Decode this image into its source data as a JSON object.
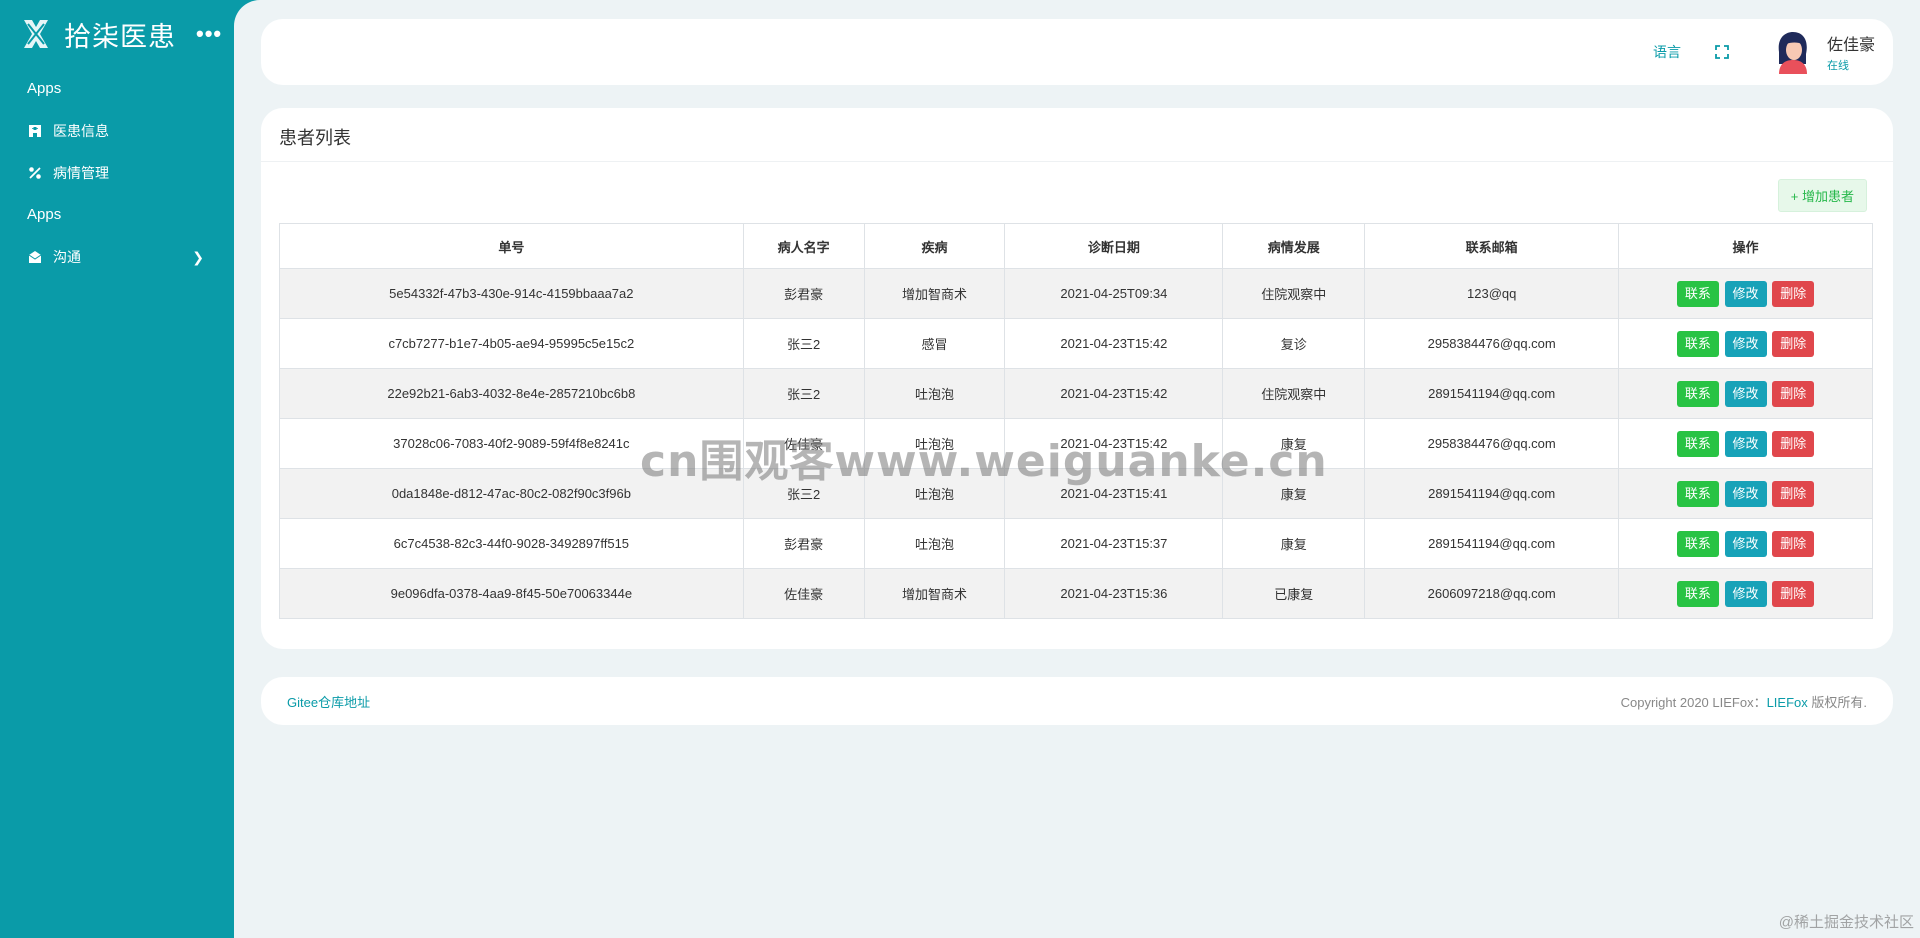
{
  "sidebar": {
    "brand_name": "拾柒医患",
    "more": "•••",
    "sections": [
      {
        "label": "Apps"
      },
      {
        "label": "Apps"
      }
    ],
    "items": [
      {
        "label": "医患信息",
        "icon": "hospital-icon"
      },
      {
        "label": "病情管理",
        "icon": "percent-icon"
      },
      {
        "label": "沟通",
        "icon": "envelope-icon"
      }
    ]
  },
  "header": {
    "language": "语言",
    "fullscreen_icon": "fullscreen-icon",
    "user_name": "佐佳豪",
    "user_status": "在线"
  },
  "card": {
    "title": "患者列表",
    "add_button": "+ 增加患者"
  },
  "table": {
    "headers": [
      "单号",
      "病人名字",
      "疾病",
      "诊断日期",
      "病情发展",
      "联系邮箱",
      "操作"
    ],
    "rows": [
      {
        "id": "5e54332f-47b3-430e-914c-4159bbaaa7a2",
        "name": "彭君豪",
        "disease": "增加智商术",
        "date": "2021-04-25T09:34",
        "progress": "住院观察中",
        "email": "123@qq"
      },
      {
        "id": "c7cb7277-b1e7-4b05-ae94-95995c5e15c2",
        "name": "张三2",
        "disease": "感冒",
        "date": "2021-04-23T15:42",
        "progress": "复诊",
        "email": "2958384476@qq.com"
      },
      {
        "id": "22e92b21-6ab3-4032-8e4e-2857210bc6b8",
        "name": "张三2",
        "disease": "吐泡泡",
        "date": "2021-04-23T15:42",
        "progress": "住院观察中",
        "email": "2891541194@qq.com"
      },
      {
        "id": "37028c06-7083-40f2-9089-59f4f8e8241c",
        "name": "佐佳豪",
        "disease": "吐泡泡",
        "date": "2021-04-23T15:42",
        "progress": "康复",
        "email": "2958384476@qq.com"
      },
      {
        "id": "0da1848e-d812-47ac-80c2-082f90c3f96b",
        "name": "张三2",
        "disease": "吐泡泡",
        "date": "2021-04-23T15:41",
        "progress": "康复",
        "email": "2891541194@qq.com"
      },
      {
        "id": "6c7c4538-82c3-44f0-9028-3492897ff515",
        "name": "彭君豪",
        "disease": "吐泡泡",
        "date": "2021-04-23T15:37",
        "progress": "康复",
        "email": "2891541194@qq.com"
      },
      {
        "id": "9e096dfa-0378-4aa9-8f45-50e70063344e",
        "name": "佐佳豪",
        "disease": "增加智商术",
        "date": "2021-04-23T15:36",
        "progress": "已康复",
        "email": "2606097218@qq.com"
      }
    ],
    "actions": {
      "contact": "联系",
      "edit": "修改",
      "delete": "删除"
    }
  },
  "footer": {
    "repo_link": "Gitee仓库地址",
    "copyright_prefix": "Copyright 2020 LIEFox：",
    "copyright_brand": "LIEFox",
    "copyright_suffix": " 版权所有."
  },
  "watermark": "cn围观客www.weiguanke.cn",
  "corner_mark": "@稀土掘金技术社区",
  "colors": {
    "primary": "#0a9ba8",
    "background": "#edf3f5",
    "contact": "#28c344",
    "edit": "#17a2b8",
    "delete": "#e0474c"
  }
}
